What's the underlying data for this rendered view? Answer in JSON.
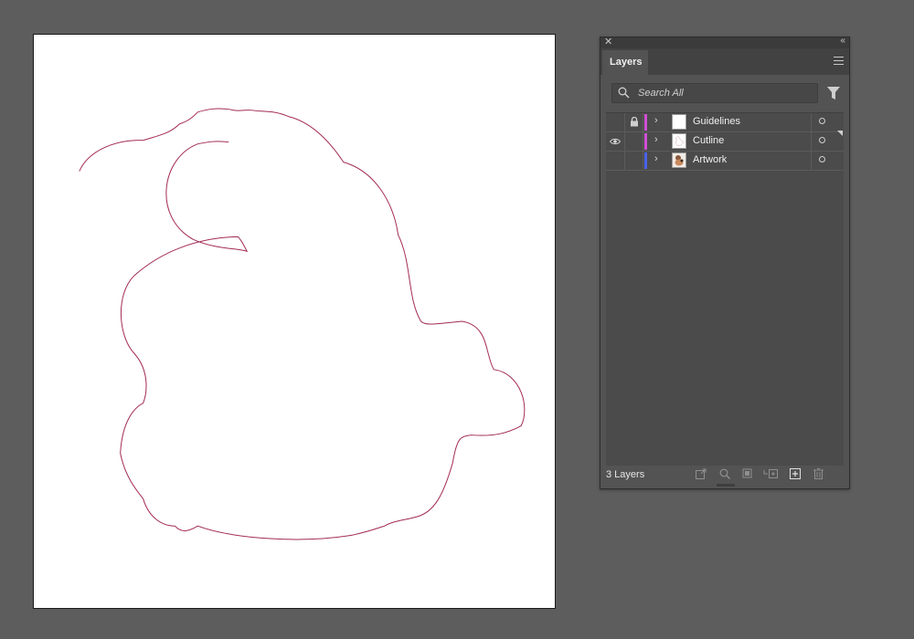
{
  "panel": {
    "tab_label": "Layers",
    "search_placeholder": "Search All",
    "layer_count": "3 Layers"
  },
  "layers": [
    {
      "name": "Guidelines",
      "color": "#d14fd6",
      "visible": false,
      "locked": true
    },
    {
      "name": "Cutline",
      "color": "#d14fd6",
      "visible": true,
      "locked": false
    },
    {
      "name": "Artwork",
      "color": "#4a63e8",
      "visible": false,
      "locked": false
    }
  ],
  "colors": {
    "cutline_stroke": "#a32a56",
    "canvas_bg": "#5d5d5d",
    "panel_bg": "#535353"
  }
}
